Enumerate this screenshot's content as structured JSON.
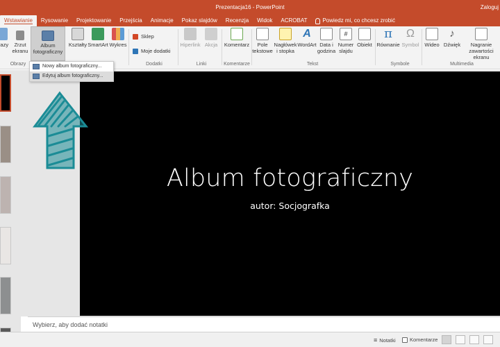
{
  "window": {
    "title": "Prezentacja16 - PowerPoint",
    "login": "Zaloguj"
  },
  "tabs": [
    {
      "label": "Wstawianie",
      "active": true
    },
    {
      "label": "Rysowanie"
    },
    {
      "label": "Projektowanie"
    },
    {
      "label": "Przejścia"
    },
    {
      "label": "Animacje"
    },
    {
      "label": "Pokaz slajdów"
    },
    {
      "label": "Recenzja"
    },
    {
      "label": "Widok"
    },
    {
      "label": "ACROBAT"
    }
  ],
  "tell_me": "Powiedz mi, co chcesz zrobić",
  "ribbon": {
    "obrazy_cut": "razy",
    "zrzut": [
      "Zrzut",
      "ekranu"
    ],
    "album": [
      "Album",
      "fotograficzny"
    ],
    "ksztalty": "Kształty",
    "smartart": "SmartArt",
    "wykres": "Wykres",
    "sklep": "Sklep",
    "moje_dodatki": "Moje dodatki",
    "hiperlink": "Hiperlink",
    "akcja": "Akcja",
    "komentarz": "Komentarz",
    "pole": [
      "Pole",
      "tekstowe"
    ],
    "naglowek": [
      "Nagłówek",
      "i stopka"
    ],
    "wordart": "WordArt",
    "data": [
      "Data i",
      "godzina"
    ],
    "numer": [
      "Numer",
      "slajdu"
    ],
    "obiekt": "Obiekt",
    "rownanie": "Równanie",
    "symbol": "Symbol",
    "wideo": "Wideo",
    "dzwiek": "Dźwięk",
    "nagranie": [
      "Nagranie",
      "zawartości ekranu"
    ],
    "groups": {
      "obrazy": "Obrazy",
      "dodatki": "Dodatki",
      "linki": "Linki",
      "komentarze": "Komentarze",
      "tekst": "Tekst",
      "symbole": "Symbole",
      "multimedia": "Multimedia"
    }
  },
  "dropdown": {
    "items": [
      "Nowy album fotograficzny...",
      "Edytuj album fotograficzny..."
    ]
  },
  "slide": {
    "title": "Album fotograficzny",
    "subtitle": "autor: Socjografka"
  },
  "notes_placeholder": "Wybierz, aby dodać notatki",
  "status": {
    "notes": "Notatki",
    "comments": "Komentarze"
  },
  "colors": {
    "accent": "#c44b2b",
    "arrow": "#1b8c96",
    "slide_bg": "#000000"
  }
}
